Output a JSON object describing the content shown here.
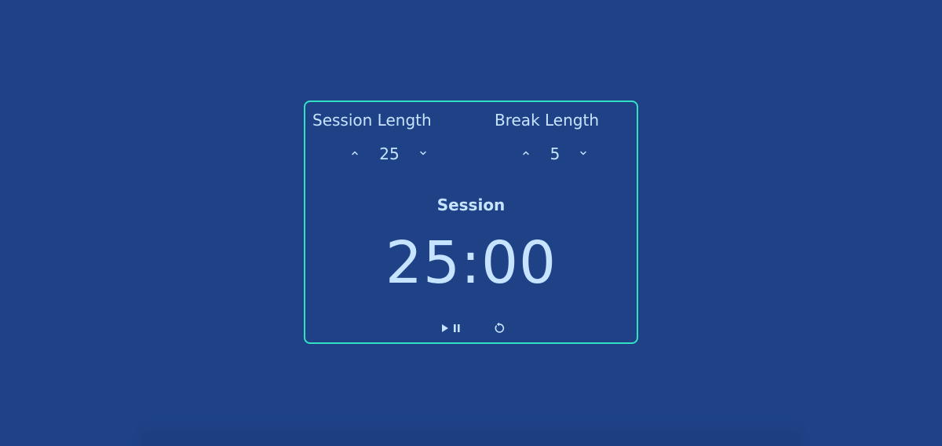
{
  "session": {
    "title": "Session Length",
    "value": "25",
    "increment_icon": "chevron-up-icon",
    "decrement_icon": "chevron-down-icon"
  },
  "break": {
    "title": "Break Length",
    "value": "5",
    "increment_icon": "chevron-up-icon",
    "decrement_icon": "chevron-down-icon"
  },
  "timer": {
    "label": "Session",
    "time": "25:00"
  },
  "controls": {
    "play_pause_icon": "play-pause-icon",
    "reset_icon": "reset-icon"
  },
  "colors": {
    "background": "#1f4287",
    "border": "#32e0c4",
    "text": "#c6e3ff"
  }
}
